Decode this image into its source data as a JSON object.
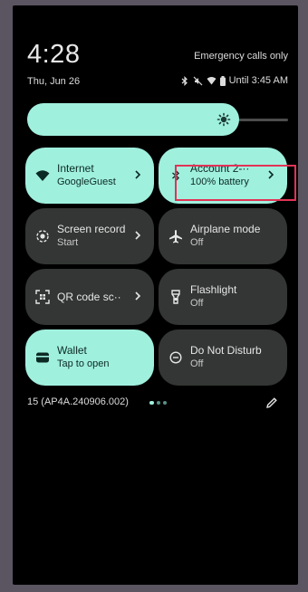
{
  "status_bar": {
    "time": "4:28",
    "emergency": "Emergency calls only",
    "date": "Thu, Jun 26",
    "alarm_text": "Until 3:45 AM"
  },
  "brightness": {
    "level": 0.78
  },
  "tiles": {
    "internet": {
      "title": "Internet",
      "subtitle": "GoogleGuest",
      "state": "on"
    },
    "bluetooth": {
      "title": "Account 2-··",
      "subtitle": "100% battery",
      "state": "on"
    },
    "screen_record": {
      "title": "Screen record",
      "subtitle": "Start",
      "state": "off"
    },
    "airplane": {
      "title": "Airplane mode",
      "subtitle": "Off",
      "state": "off"
    },
    "qr": {
      "title": "QR code sc··",
      "state": "off"
    },
    "flashlight": {
      "title": "Flashlight",
      "subtitle": "Off",
      "state": "off"
    },
    "wallet": {
      "title": "Wallet",
      "subtitle": "Tap to open",
      "state": "on"
    },
    "dnd": {
      "title": "Do Not Disturb",
      "subtitle": "Off",
      "state": "off"
    }
  },
  "footer": {
    "build": "15 (AP4A.240906.002)",
    "page_dots": 3,
    "active_page": 1
  },
  "colors": {
    "tile_on": "#a0f0de",
    "tile_off": "#333634",
    "highlight": "#e23356"
  },
  "icons": {
    "wifi": "wifi-icon",
    "bluetooth": "bluetooth-icon",
    "screen_record": "record-icon",
    "airplane": "airplane-icon",
    "qr": "qr-icon",
    "flashlight": "flashlight-icon",
    "wallet": "wallet-icon",
    "dnd": "dnd-icon",
    "edit": "pencil-icon"
  }
}
